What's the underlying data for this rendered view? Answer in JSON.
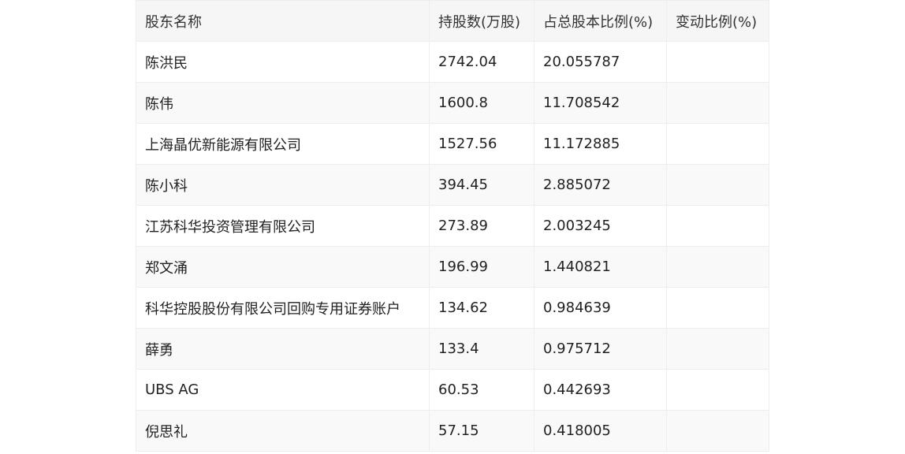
{
  "table": {
    "headers": [
      "股东名称",
      "持股数(万股)",
      "占总股本比例(%)",
      "变动比例(%)"
    ],
    "rows": [
      [
        "陈洪民",
        "2742.04",
        "20.055787",
        ""
      ],
      [
        "陈伟",
        "1600.8",
        "11.708542",
        ""
      ],
      [
        "上海晶优新能源有限公司",
        "1527.56",
        "11.172885",
        ""
      ],
      [
        "陈小科",
        "394.45",
        "2.885072",
        ""
      ],
      [
        "江苏科华投资管理有限公司",
        "273.89",
        "2.003245",
        ""
      ],
      [
        "郑文涌",
        "196.99",
        "1.440821",
        ""
      ],
      [
        "科华控股股份有限公司回购专用证券账户",
        "134.62",
        "0.984639",
        ""
      ],
      [
        "薛勇",
        "133.4",
        "0.975712",
        ""
      ],
      [
        "UBS AG",
        "60.53",
        "0.442693",
        ""
      ],
      [
        "倪思礼",
        "57.15",
        "0.418005",
        ""
      ]
    ]
  }
}
